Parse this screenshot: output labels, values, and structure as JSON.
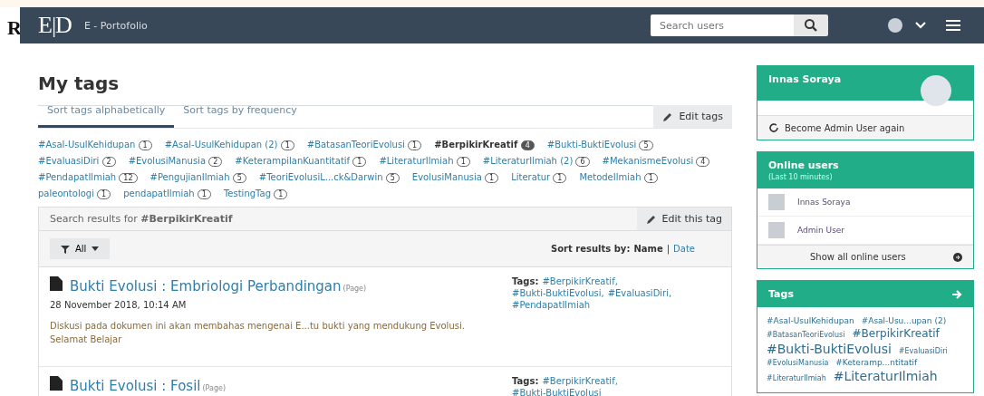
{
  "page_heading": "R",
  "navbar": {
    "logo": "E|D",
    "site_name": "E - Portofolio",
    "search": {
      "placeholder": "Search users"
    }
  },
  "title": "My tags",
  "edit_tags": "Edit tags",
  "tabs": [
    {
      "label": "Sort tags alphabetically",
      "selected": true
    },
    {
      "label": "Sort tags by frequency",
      "selected": false
    }
  ],
  "tag_list": [
    {
      "label": "#Asal-UsulKehidupan",
      "count": "1",
      "selected": false
    },
    {
      "label": "#Asal-UsulKehidupan (2)",
      "count": "1",
      "selected": false
    },
    {
      "label": "#BatasanTeoriEvolusi",
      "count": "1",
      "selected": false
    },
    {
      "label": "#BerpikirKreatif",
      "count": "4",
      "selected": true
    },
    {
      "label": "#Bukti-BuktiEvolusi",
      "count": "5",
      "selected": false
    },
    {
      "label": "#EvaluasiDiri",
      "count": "2",
      "selected": false
    },
    {
      "label": "#EvolusiManusia",
      "count": "2",
      "selected": false
    },
    {
      "label": "#KeterampilanKuantitatif",
      "count": "1",
      "selected": false
    },
    {
      "label": "#LiteraturIlmiah",
      "count": "1",
      "selected": false
    },
    {
      "label": "#LiteraturIlmiah (2)",
      "count": "6",
      "selected": false
    },
    {
      "label": "#MekanismeEvolusi",
      "count": "4",
      "selected": false
    },
    {
      "label": "#PendapatIlmiah",
      "count": "12",
      "selected": false
    },
    {
      "label": "#PengujianIlmiah",
      "count": "5",
      "selected": false
    },
    {
      "label": "#TeoriEvolusiL...ck&Darwin",
      "count": "5",
      "selected": false
    },
    {
      "label": "EvolusiManusia",
      "count": "1",
      "selected": false
    },
    {
      "label": "Literatur",
      "count": "1",
      "selected": false
    },
    {
      "label": "MetodeIlmiah",
      "count": "1",
      "selected": false
    },
    {
      "label": "paleontologi",
      "count": "1",
      "selected": false
    },
    {
      "label": "pendapatIlmiah",
      "count": "1",
      "selected": false
    },
    {
      "label": "TestingTag",
      "count": "1",
      "selected": false
    }
  ],
  "results": {
    "heading": "Search results for **#BerpikirKreatif**",
    "edit_tag": "Edit this tag",
    "filter": "All",
    "sort_label": "Sort results by:",
    "sort_name": "Name",
    "sort_separator": "|",
    "sort_date": "Date",
    "items": [
      {
        "title": "Bukti Evolusi : Embriologi Perbandingan",
        "type": "(Page)",
        "date": "28 November 2018, 10:14 AM",
        "description": "Diskusi pada dokumen ini akan membahas mengenai E...tu bukti yang mendukung Evolusi. Selamat Belajar",
        "tags_label": "Tags:",
        "tags": [
          "#BerpikirKreatif,",
          "#Bukti-BuktiEvolusi,",
          "#EvaluasiDiri,",
          "#PendapatIlmiah"
        ]
      },
      {
        "title": "Bukti Evolusi : Fosil",
        "type": "(Page)",
        "tags_label": "Tags:",
        "tags": [
          "#BerpikirKreatif,",
          "#Bukti-BuktiEvolusi"
        ]
      }
    ]
  },
  "profile": {
    "name": "Innas Soraya",
    "action": "Become Admin User again"
  },
  "online": {
    "title": "Online users",
    "subtitle": "(Last 10 minutes)",
    "users": [
      "Innas Soraya",
      "Admin User"
    ],
    "footer": "Show all online users"
  },
  "tag_cloud": {
    "title": "Tags",
    "tags": [
      {
        "label": "#Asal-UsulKehidupan",
        "kind": "small"
      },
      {
        "label": "#Asal-Usu...upan (2)",
        "kind": "small"
      },
      {
        "label": "#BatasanTeoriEvolusi",
        "kind": "tiny"
      },
      {
        "label": "#BerpikirKreatif",
        "kind": "medium"
      },
      {
        "label": "#Bukti-BuktiEvolusi",
        "kind": "large"
      },
      {
        "label": "#EvaluasiDiri",
        "kind": "tiny"
      },
      {
        "label": "#EvolusiManusia",
        "kind": "tiny"
      },
      {
        "label": "#Keteramp...ntitatif",
        "kind": "small"
      },
      {
        "label": "#LiteraturIlmiah",
        "kind": "tiny"
      },
      {
        "label": "#LiteraturIlmiah",
        "kind": "large"
      }
    ]
  }
}
